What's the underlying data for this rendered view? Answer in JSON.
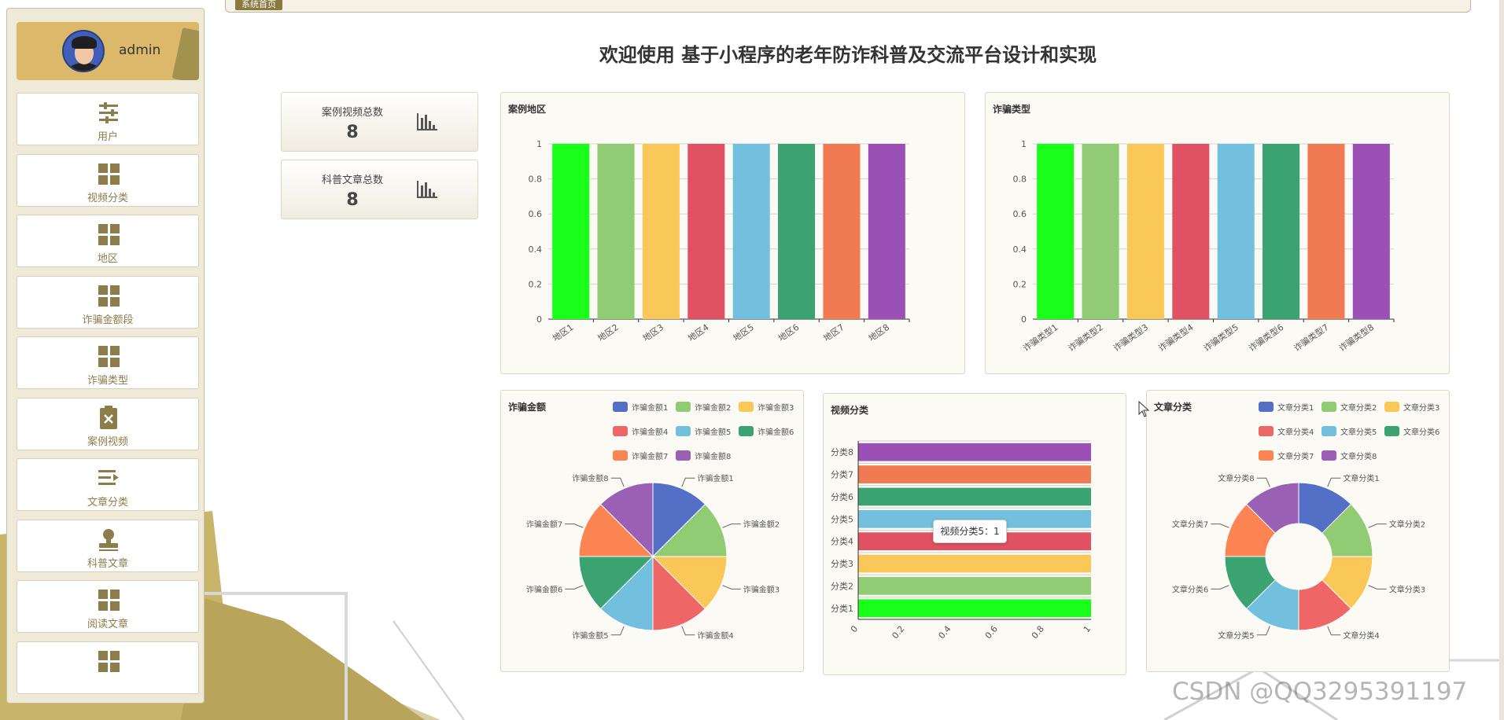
{
  "breadcrumb": "系统首页",
  "user": {
    "name": "admin"
  },
  "title": "欢迎使用 基于小程序的老年防诈科普及交流平台设计和实现",
  "menu": [
    {
      "label": "用户",
      "icon": "sliders-icon"
    },
    {
      "label": "视频分类",
      "icon": "grid-icon"
    },
    {
      "label": "地区",
      "icon": "grid-icon"
    },
    {
      "label": "诈骗金额段",
      "icon": "grid-icon"
    },
    {
      "label": "诈骗类型",
      "icon": "grid-icon"
    },
    {
      "label": "案例视频",
      "icon": "clipboard-x-icon"
    },
    {
      "label": "文章分类",
      "icon": "list-arrow-icon"
    },
    {
      "label": "科普文章",
      "icon": "stamp-icon"
    },
    {
      "label": "阅读文章",
      "icon": "grid-icon"
    },
    {
      "label": "",
      "icon": "grid-icon"
    }
  ],
  "stats": [
    {
      "label": "案例视频总数",
      "value": "8",
      "icon": "bar-chart-icon"
    },
    {
      "label": "科普文章总数",
      "value": "8",
      "icon": "bar-chart-icon"
    }
  ],
  "colors": {
    "palette": [
      "#5470c6",
      "#91cc75",
      "#fac858",
      "#ee6666",
      "#73c0de",
      "#3ba272",
      "#fc8452",
      "#9a60b4"
    ],
    "bar_palette": [
      "#1aff1a",
      "#91cc75",
      "#fac858",
      "#e05263",
      "#73c0de",
      "#3ba272",
      "#f07a52",
      "#9a50b4"
    ]
  },
  "tooltip": "视频分类5：1",
  "watermark": "CSDN @QQ3295391197",
  "chart_data": [
    {
      "id": "region",
      "type": "bar",
      "title": "案例地区",
      "categories": [
        "地区1",
        "地区2",
        "地区3",
        "地区4",
        "地区5",
        "地区6",
        "地区7",
        "地区8"
      ],
      "values": [
        1,
        1,
        1,
        1,
        1,
        1,
        1,
        1
      ],
      "ylim": [
        0,
        1
      ],
      "yticks": [
        "0",
        "0.2",
        "0.4",
        "0.6",
        "0.8",
        "1"
      ],
      "grid": true
    },
    {
      "id": "fraud_type",
      "type": "bar",
      "title": "诈骗类型",
      "categories": [
        "诈骗类型1",
        "诈骗类型2",
        "诈骗类型3",
        "诈骗类型4",
        "诈骗类型5",
        "诈骗类型6",
        "诈骗类型7",
        "诈骗类型8"
      ],
      "values": [
        1,
        1,
        1,
        1,
        1,
        1,
        1,
        1
      ],
      "ylim": [
        0,
        1
      ],
      "yticks": [
        "0",
        "0.2",
        "0.4",
        "0.6",
        "0.8",
        "1"
      ],
      "grid": true
    },
    {
      "id": "fraud_amount",
      "type": "pie",
      "title": "诈骗金额",
      "categories": [
        "诈骗金额1",
        "诈骗金额2",
        "诈骗金额3",
        "诈骗金额4",
        "诈骗金额5",
        "诈骗金额6",
        "诈骗金额7",
        "诈骗金额8"
      ],
      "values": [
        1,
        1,
        1,
        1,
        1,
        1,
        1,
        1
      ],
      "legend": "top-right"
    },
    {
      "id": "video_category",
      "type": "bar",
      "orientation": "horizontal",
      "title": "视频分类",
      "categories": [
        "分类1",
        "分类2",
        "分类3",
        "分类4",
        "分类5",
        "分类6",
        "分类7",
        "分类8"
      ],
      "values": [
        1,
        1,
        1,
        1,
        1,
        1,
        1,
        1
      ],
      "xlim": [
        0,
        1
      ],
      "xticks": [
        "0",
        "0.2",
        "0.4",
        "0.6",
        "0.8",
        "1"
      ],
      "grid": true
    },
    {
      "id": "article_category",
      "type": "pie",
      "variant": "donut",
      "title": "文章分类",
      "categories": [
        "文章分类1",
        "文章分类2",
        "文章分类3",
        "文章分类4",
        "文章分类5",
        "文章分类6",
        "文章分类7",
        "文章分类8"
      ],
      "values": [
        1,
        1,
        1,
        1,
        1,
        1,
        1,
        1
      ],
      "legend": "top-right"
    }
  ]
}
